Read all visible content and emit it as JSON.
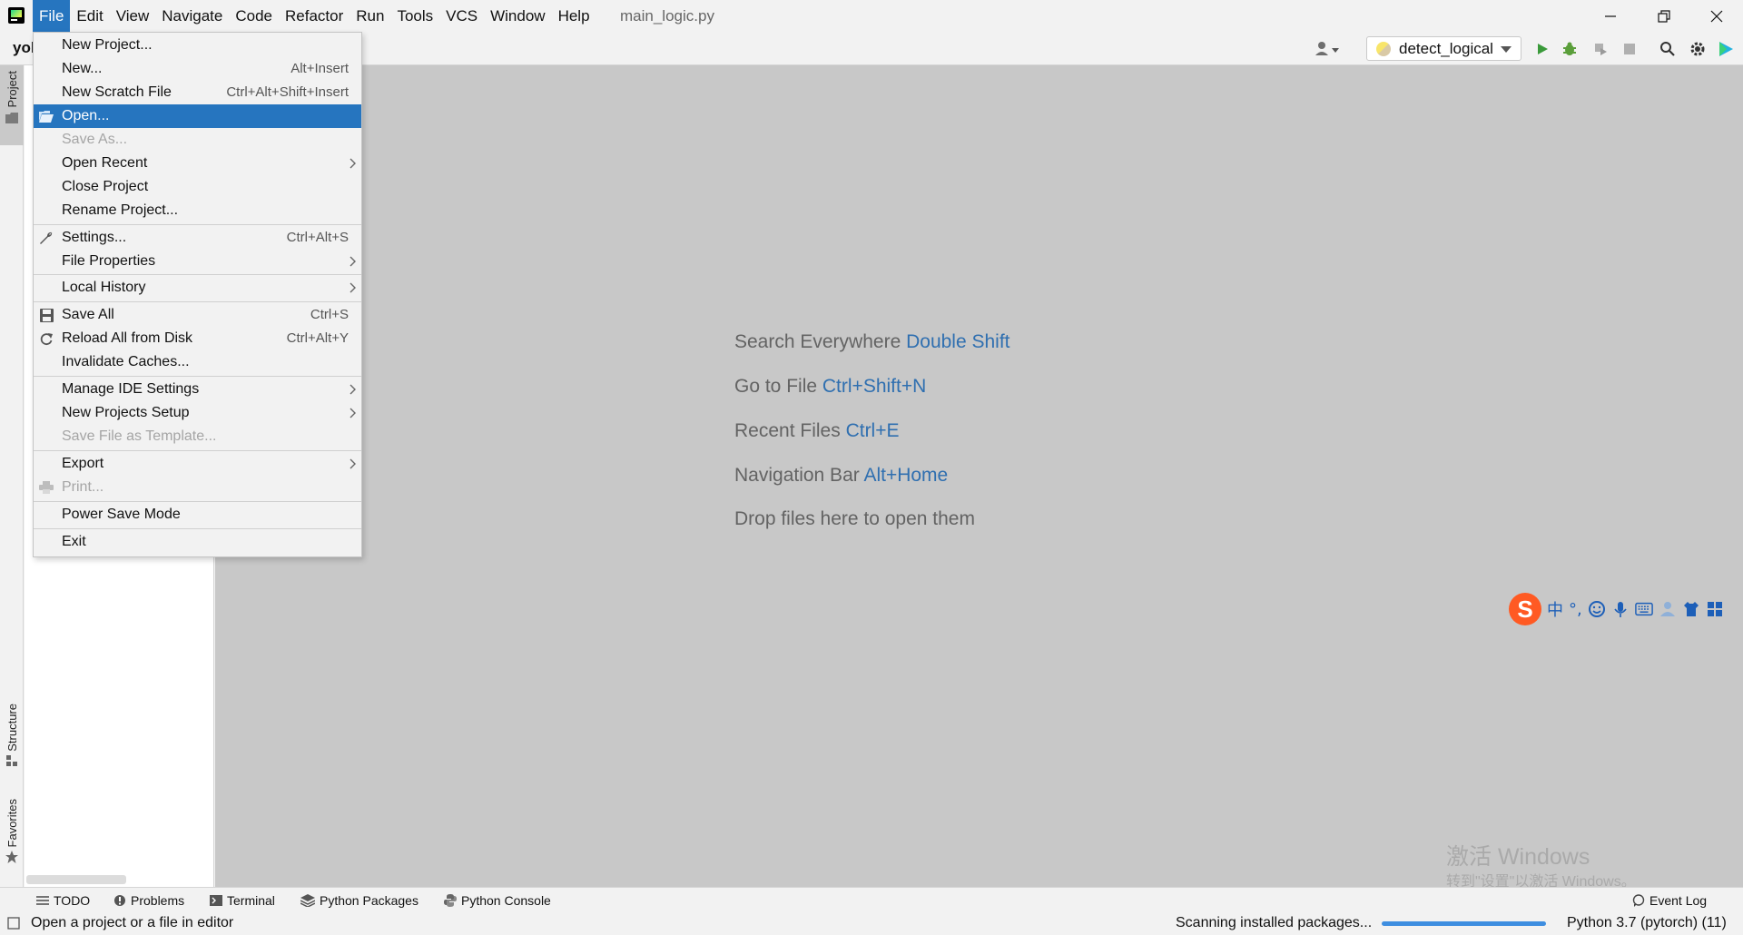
{
  "menubar": {
    "items": [
      "File",
      "Edit",
      "View",
      "Navigate",
      "Code",
      "Refactor",
      "Run",
      "Tools",
      "VCS",
      "Window",
      "Help"
    ],
    "active": "File"
  },
  "window": {
    "filename": "main_logic.py"
  },
  "toolbar": {
    "project_short": "yol",
    "run_config": "detect_logical"
  },
  "left_strip": {
    "project": "Project",
    "structure": "Structure",
    "favorites": "Favorites"
  },
  "file_menu": {
    "new_project": "New Project...",
    "new": "New...",
    "new_shortcut": "Alt+Insert",
    "new_scratch": "New Scratch File",
    "new_scratch_shortcut": "Ctrl+Alt+Shift+Insert",
    "open": "Open...",
    "save_as": "Save As...",
    "open_recent": "Open Recent",
    "close_project": "Close Project",
    "rename_project": "Rename Project...",
    "settings": "Settings...",
    "settings_shortcut": "Ctrl+Alt+S",
    "file_properties": "File Properties",
    "local_history": "Local History",
    "save_all": "Save All",
    "save_all_shortcut": "Ctrl+S",
    "reload": "Reload All from Disk",
    "reload_shortcut": "Ctrl+Alt+Y",
    "invalidate": "Invalidate Caches...",
    "manage_ide": "Manage IDE Settings",
    "new_projects_setup": "New Projects Setup",
    "save_template": "Save File as Template...",
    "export": "Export",
    "print": "Print...",
    "power_save": "Power Save Mode",
    "exit": "Exit"
  },
  "editor_hints": {
    "search_label": "Search Everywhere",
    "search_key": "Double Shift",
    "goto_label": "Go to File",
    "goto_key": "Ctrl+Shift+N",
    "recent_label": "Recent Files",
    "recent_key": "Ctrl+E",
    "navbar_label": "Navigation Bar",
    "navbar_key": "Alt+Home",
    "drop": "Drop files here to open them"
  },
  "ime": {
    "logo": "S",
    "lang": "中",
    "punct": "°,"
  },
  "watermark": {
    "line1": "激活 Windows",
    "line2": "转到\"设置\"以激活 Windows。"
  },
  "bottom_tools": {
    "todo": "TODO",
    "problems": "Problems",
    "terminal": "Terminal",
    "python_packages": "Python Packages",
    "python_console": "Python Console",
    "event_log": "Event Log"
  },
  "status": {
    "message": "Open a project or a file in editor",
    "scanning": "Scanning installed packages...",
    "progress": 1.0,
    "interpreter": "Python 3.7 (pytorch) (11)"
  },
  "colors": {
    "accent": "#2675bf",
    "hint_key": "#2f6fb0",
    "run_green": "#3a9a3a"
  }
}
